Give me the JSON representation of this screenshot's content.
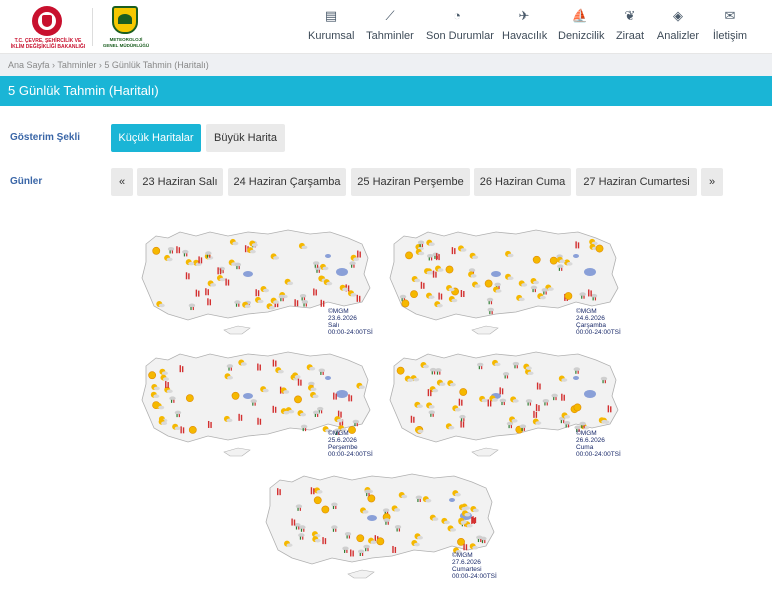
{
  "header": {
    "ministry_line1": "T.C. ÇEVRE, ŞEHİRCİLİK VE",
    "ministry_line2": "İKLİM DEĞİŞİKLİĞİ BAKANLIĞI",
    "mgm_line1": "METEOROLOJİ",
    "mgm_line2": "GENEL MÜDÜRLÜĞÜ"
  },
  "nav": [
    {
      "label": "Kurumsal",
      "icon": "document-icon",
      "glyph": "▤"
    },
    {
      "label": "Tahminler",
      "icon": "chart-icon",
      "glyph": "⟋"
    },
    {
      "label": "Son Durumlar",
      "icon": "gauge-icon",
      "glyph": "◔"
    },
    {
      "label": "Havacılık",
      "icon": "plane-icon",
      "glyph": "✈"
    },
    {
      "label": "Denizcilik",
      "icon": "sailboat-icon",
      "glyph": "⛵"
    },
    {
      "label": "Ziraat",
      "icon": "leaf-icon",
      "glyph": "❦"
    },
    {
      "label": "Analizler",
      "icon": "analysis-icon",
      "glyph": "◈"
    },
    {
      "label": "İletişim",
      "icon": "envelope-icon",
      "glyph": "✉"
    }
  ],
  "breadcrumb": {
    "home": "Ana Sayfa",
    "sep": " › ",
    "forecasts": "Tahminler",
    "current": "5 Günlük Tahmin (Haritalı)"
  },
  "page_title": "5 Günlük Tahmin (Haritalı)",
  "display_mode": {
    "label": "Gösterim Şekli",
    "options": [
      "Küçük Haritalar",
      "Büyük Harita"
    ],
    "selected": 0
  },
  "days": {
    "label": "Günler",
    "prev": "«",
    "next": "»",
    "items": [
      "23 Haziran Salı",
      "24 Haziran Çarşamba",
      "25 Haziran Perşembe",
      "26 Haziran Cuma",
      "27 Haziran Cumartesi"
    ]
  },
  "maps": [
    {
      "source": "©MGM",
      "date": "23.6.2026",
      "day": "Salı",
      "period": "00:00-24:00TSİ"
    },
    {
      "source": "©MGM",
      "date": "24.6.2026",
      "day": "Çarşamba",
      "period": "00:00-24:00TSİ"
    },
    {
      "source": "©MGM",
      "date": "25.6.2026",
      "day": "Perşembe",
      "period": "00:00-24:00TSİ"
    },
    {
      "source": "©MGM",
      "date": "26.6.2026",
      "day": "Cuma",
      "period": "00:00-24:00TSİ"
    },
    {
      "source": "©MGM",
      "date": "27.6.2026",
      "day": "Cumartesi",
      "period": "00:00-24:00TSİ"
    }
  ],
  "colors": {
    "accent": "#1ab5d6",
    "label_blue": "#3a66a7",
    "sun": "#f5b800",
    "thunder_red": "#d32f2f",
    "storm_green": "#2e7d32",
    "lake": "#8aa0d8"
  }
}
